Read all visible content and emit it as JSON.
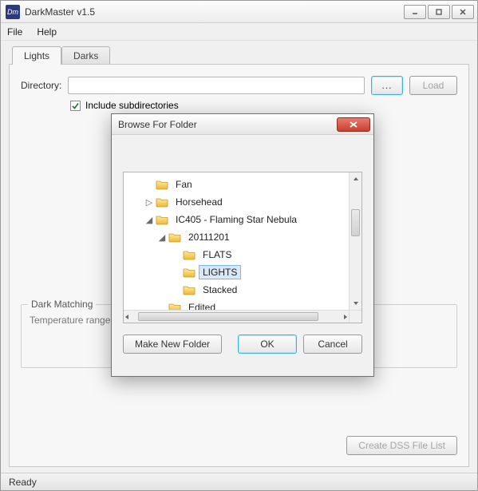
{
  "app": {
    "icon_text": "Dm",
    "title": "DarkMaster v1.5"
  },
  "menu": {
    "file": "File",
    "help": "Help"
  },
  "tabs": {
    "lights": "Lights",
    "darks": "Darks"
  },
  "directory": {
    "label": "Directory:",
    "value": "",
    "browse_label": "...",
    "load_label": "Load",
    "include_sub_label": "Include subdirectories",
    "include_sub_checked": true
  },
  "group": {
    "title": "Dark Matching",
    "body_stub": "Temperature range to"
  },
  "bottom": {
    "create_label": "Create DSS File List"
  },
  "status": {
    "text": "Ready"
  },
  "dialog": {
    "title": "Browse For Folder",
    "make_new": "Make New Folder",
    "ok": "OK",
    "cancel": "Cancel",
    "tree": [
      {
        "indent": 1,
        "twisty": "",
        "label": "Fan",
        "selected": false
      },
      {
        "indent": 1,
        "twisty": "▷",
        "label": "Horsehead",
        "selected": false
      },
      {
        "indent": 1,
        "twisty": "◢",
        "label": "IC405 - Flaming Star Nebula",
        "selected": false
      },
      {
        "indent": 2,
        "twisty": "◢",
        "label": "20111201",
        "selected": false
      },
      {
        "indent": 3,
        "twisty": "",
        "label": "FLATS",
        "selected": false
      },
      {
        "indent": 3,
        "twisty": "",
        "label": "LIGHTS",
        "selected": true
      },
      {
        "indent": 3,
        "twisty": "",
        "label": "Stacked",
        "selected": false
      },
      {
        "indent": 2,
        "twisty": "",
        "label": "Edited",
        "selected": false
      }
    ]
  }
}
